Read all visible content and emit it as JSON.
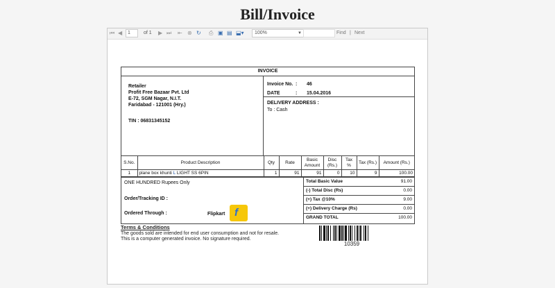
{
  "page": {
    "title": "Bill/Invoice"
  },
  "toolbar": {
    "page_value": "1",
    "page_of": "of 1",
    "zoom": "100%",
    "find_label": "Find",
    "sep": "|",
    "next_label": "Next"
  },
  "invoice": {
    "heading": "INVOICE",
    "retailer": {
      "label": "Retailer",
      "name": "Profit Free Bazaar Pvt. Ltd",
      "address1": "E-72, SGM Nagar, N.I.T.",
      "address2": "Faridabad - 121001 (Hry.)",
      "tin": "TIN : 06831345152"
    },
    "meta": {
      "invoice_no_label": "Invoice No.",
      "invoice_no": "46",
      "date_label": "DATE",
      "date": "15.04.2016",
      "colon": ":"
    },
    "delivery": {
      "label": "DELIVERY ADDRESS :",
      "to": "To : Cash"
    },
    "columns": [
      "S.No.",
      "Product Description",
      "Qty",
      "Rate",
      "Basic Amount",
      "Disc (Rs.)",
      "Tax %",
      "Tax (Rs.)",
      "Amount (Rs.)"
    ],
    "items": [
      {
        "sno": "1",
        "desc_prefix": "plane box khunti ",
        "desc_highlight": "L",
        "desc_suffix": " LIGHT SS 6PIN",
        "qty": "1",
        "rate": "91",
        "basic": "91",
        "disc": "0",
        "tax_pct": "10",
        "tax_rs": "9",
        "amount": "100.00"
      }
    ],
    "amount_words": "ONE HUNDRED  Rupees Only",
    "order_tracking_label": "Order/Tracking ID :",
    "ordered_through_label": "Ordered Through  :",
    "ordered_through_value": "Flipkart",
    "totals": [
      {
        "label": "Total Basic Value",
        "value": "91.00"
      },
      {
        "label": "(-) Total Disc (Rs)",
        "value": "0.00"
      },
      {
        "label": "(+) Tax @10%",
        "value": "9.00"
      },
      {
        "label": "(+) Delivery Charge (Rs)",
        "value": "0.00"
      },
      {
        "label": "GRAND TOTAL",
        "value": "100.00"
      }
    ]
  },
  "terms": {
    "heading": "Terms & Conditions",
    "line1": "The goods sold are intended for end user consumption and not for resale.",
    "line2": "This is a computer generated invoice. No signature required."
  },
  "barcode": {
    "number": "10359"
  },
  "colors": {
    "accent_blue": "#1a4fa0",
    "flipkart_yellow": "#f6c70a",
    "flipkart_blue": "#2a6ed2"
  }
}
